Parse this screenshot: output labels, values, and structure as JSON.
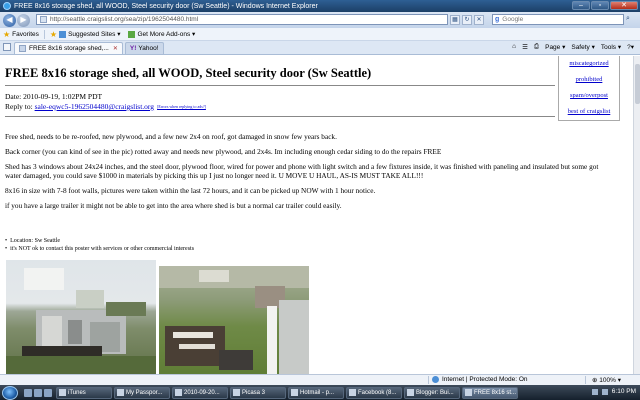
{
  "window": {
    "title": "FREE 8x16 storage shed, all WOOD, Steel security door (Sw Seattle) - Windows Internet Explorer"
  },
  "address_bar": {
    "url": "http://seattle.craigslist.org/sea/zip/1962504480.html",
    "search_placeholder": "Google"
  },
  "favorites_bar": {
    "favorites_label": "Favorites",
    "items": [
      "Suggested Sites ▾",
      "Get More Add-ons ▾"
    ]
  },
  "tabs": [
    {
      "label": "FREE 8x16 storage shed,...",
      "active": true
    },
    {
      "label": "Yahoo!",
      "active": false
    }
  ],
  "command_bar": [
    "Page ▾",
    "Safety ▾",
    "Tools ▾",
    "?▾"
  ],
  "posting": {
    "title": "FREE 8x16 storage shed, all WOOD, Steel security door (Sw Seattle)",
    "date_line": "Date: 2010-09-19,  1:02PM PDT",
    "reply_label": "Reply to: ",
    "reply_email": "sale-eqwc5-1962504480@craigslist.org",
    "reply_help": "[Errors when replying to ads?]",
    "flags": [
      "miscategorized",
      "prohibited",
      "spam/overpost",
      "best of craigslist"
    ],
    "paragraphs": [
      "Free shed, needs to be re-roofed, new plywood, and a few new 2x4 on roof, got damaged in snow few years back.",
      "Back corner (you can kind of see in the pic) rotted away and needs new plywood, and 2x4s. Im including enough cedar siding to do the repairs FREE",
      "Shed has 3 windows about 24x24 inches, and the steel door, plywood floor, wired for power and phone with light switch and a few fixtures inside, it was finished with paneling and insulated but some got water damaged, you could save $1000 in materials by picking this up I just no longer need it. U MOVE U HAUL, AS-IS MUST TAKE ALL!!!",
      "8x16 in size with 7-8 foot walls, pictures were taken within the last 72 hours, and it can be picked up NOW with 1 hour notice.",
      "if you have a large trailer it might not be able to get into the area where shed is but a normal car trailer could easily."
    ],
    "bullets": [
      "Location: Sw Seattle",
      "it's NOT ok to contact this poster with services or other commercial interests"
    ]
  },
  "status_bar": {
    "zone": "Internet | Protected Mode: On",
    "zoom": "100%"
  },
  "taskbar": {
    "tasks": [
      {
        "label": "iTunes",
        "active": false
      },
      {
        "label": "My Passpor...",
        "active": false
      },
      {
        "label": "2010-09-20...",
        "active": false
      },
      {
        "label": "Picasa 3",
        "active": false
      },
      {
        "label": "Hotmail - p...",
        "active": false
      },
      {
        "label": "Facebook (8...",
        "active": false
      },
      {
        "label": "Blogger: Bui...",
        "active": false
      },
      {
        "label": "FREE 8x16 st...",
        "active": true
      }
    ],
    "clock": "6:10 PM"
  }
}
